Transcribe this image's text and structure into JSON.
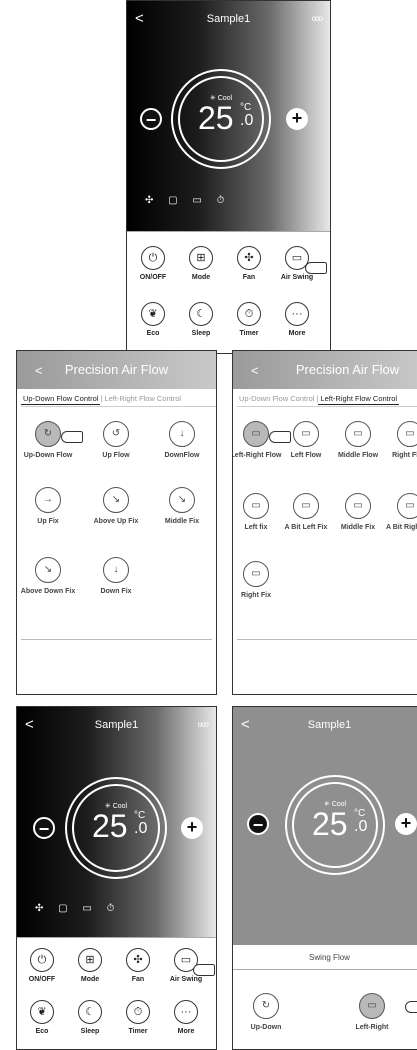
{
  "screen1": {
    "back": "<",
    "title": "Sample1",
    "menu_dots": "ooo",
    "mode": "✳ Cool",
    "temp_int": "25",
    "temp_unit": "°C",
    "temp_dec": ".0",
    "minus": "−",
    "plus": "+",
    "controls": [
      {
        "label": "ON/OFF",
        "icon": "⏻"
      },
      {
        "label": "Mode",
        "icon": "⊞"
      },
      {
        "label": "Fan",
        "icon": "✣"
      },
      {
        "label": "Air Swing",
        "icon": "▭"
      },
      {
        "label": "Eco",
        "icon": "❦"
      },
      {
        "label": "Sleep",
        "icon": "☾"
      },
      {
        "label": "Timer",
        "icon": "⏱"
      },
      {
        "label": "More",
        "icon": "···"
      }
    ]
  },
  "precision_left": {
    "back": "<",
    "title": "Precision Air Flow",
    "tab_active": "Up-Down Flow Control",
    "tab_inactive": "Left-Right Flow Control",
    "options": [
      {
        "label": "Up-Down Flow",
        "icon": "↻"
      },
      {
        "label": "Up Flow",
        "icon": "↺"
      },
      {
        "label": "DownFlow",
        "icon": "↓"
      },
      {
        "label": "Up Fix",
        "icon": "→"
      },
      {
        "label": "Above Up Fix",
        "icon": "↘"
      },
      {
        "label": "Middle Fix",
        "icon": "↘"
      },
      {
        "label": "Above Down Fix",
        "icon": "↘"
      },
      {
        "label": "Down Fix",
        "icon": "↓"
      }
    ]
  },
  "precision_right": {
    "back": "<",
    "title": "Precision Air Flow",
    "tab_inactive": "Up-Down Flow Control",
    "tab_active": "Left-Right Flow Control",
    "options": [
      {
        "label": "Left-Right Flow",
        "icon": "▭"
      },
      {
        "label": "Left Flow",
        "icon": "▭"
      },
      {
        "label": "Middle Flow",
        "icon": "▭"
      },
      {
        "label": "Right Flow",
        "icon": "▭"
      },
      {
        "label": "Left fix",
        "icon": "▭"
      },
      {
        "label": "A Bit Left Fix",
        "icon": "▭"
      },
      {
        "label": "Middle Fix",
        "icon": "▭"
      },
      {
        "label": "A Bit Right Fix",
        "icon": "▭"
      },
      {
        "label": "Right Fix",
        "icon": "▭"
      }
    ]
  },
  "screen3": {
    "back": "<",
    "title": "Sample1",
    "menu_dots": "ooo",
    "mode": "✳ Cool",
    "temp_int": "25",
    "temp_unit": "°C",
    "temp_dec": ".0",
    "minus": "−",
    "plus": "+",
    "controls": [
      {
        "label": "ON/OFF",
        "icon": "⏻"
      },
      {
        "label": "Mode",
        "icon": "⊞"
      },
      {
        "label": "Fan",
        "icon": "✣"
      },
      {
        "label": "Air Swing",
        "icon": "▭"
      },
      {
        "label": "Eco",
        "icon": "❦"
      },
      {
        "label": "Sleep",
        "icon": "☾"
      },
      {
        "label": "Timer",
        "icon": "⏱"
      },
      {
        "label": "More",
        "icon": "···"
      }
    ]
  },
  "screen4": {
    "back": "<",
    "title": "Sample1",
    "mode": "✳ Cool",
    "temp_int": "25",
    "temp_unit": "°C",
    "temp_dec": ".0",
    "minus": "−",
    "plus": "+",
    "swing_title": "Swing Flow",
    "swing_options": [
      {
        "label": "Up-Down",
        "icon": "↻"
      },
      {
        "label": "Left-Right",
        "icon": "▭"
      }
    ]
  }
}
